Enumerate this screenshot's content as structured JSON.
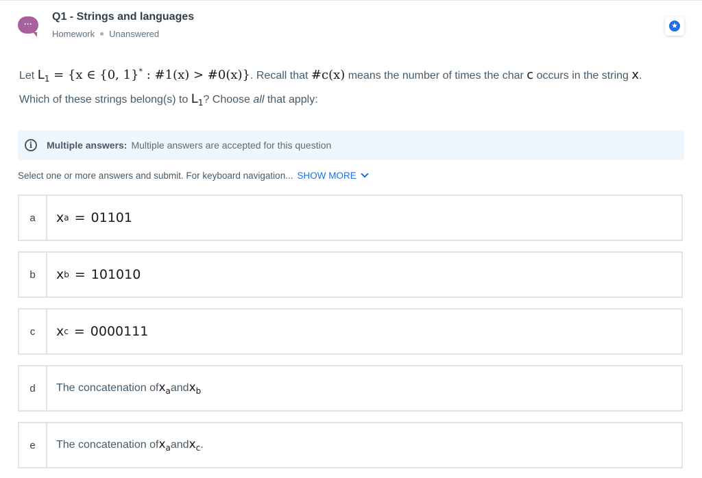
{
  "header": {
    "question_icon": "speech-bubble-ellipsis-icon",
    "question_icon_glyph": "···",
    "title": "Q1 - Strings and languages",
    "category": "Homework",
    "status": "Unanswered",
    "bookmark_icon": "star-icon",
    "bookmark_glyph": "★"
  },
  "prompt": {
    "let": "Let ",
    "L": "L",
    "L_sub": "1",
    "definition_a": " = {x ∈ {0, 1}",
    "star": "*",
    "definition_b": " : #1(x) > #0(x)}",
    "recall": ". Recall that ",
    "hashcx": "#c(x)",
    "means": " means the number of times the char ",
    "c": "c",
    "occurs": " occurs in the string ",
    "x": "x",
    "period": ".",
    "line2_a": "Which of these strings belong(s) to ",
    "line2_b": "? Choose ",
    "line2_all": "all",
    "line2_c": " that apply:"
  },
  "info": {
    "icon": "info-icon",
    "glyph": "i",
    "label": "Multiple answers:",
    "text": "Multiple answers are accepted for this question"
  },
  "instructions": {
    "text": "Select one or more answers and submit. For keyboard navigation...",
    "show_more": "SHOW MORE"
  },
  "options": [
    {
      "letter": "a",
      "var": "x",
      "sub": "a",
      "eq": "=",
      "value": "01101"
    },
    {
      "letter": "b",
      "var": "x",
      "sub": "b",
      "eq": "=",
      "value": "101010"
    },
    {
      "letter": "c",
      "var": "x",
      "sub": "c",
      "eq": "=",
      "value": "0000111"
    },
    {
      "letter": "d",
      "text": "The concatenation of ",
      "var1": "x",
      "sub1": "a",
      "and": " and ",
      "var2": "x",
      "sub2": "b",
      "end": ""
    },
    {
      "letter": "e",
      "text": "The concatenation of ",
      "var1": "x",
      "sub1": "a",
      "and": " and ",
      "var2": "x",
      "sub2": "c",
      "end": "."
    }
  ],
  "colors": {
    "accent": "#1e6ee4",
    "question_icon": "#a8609e",
    "info_bg": "#eff6fe",
    "border": "#e1e3e7"
  }
}
